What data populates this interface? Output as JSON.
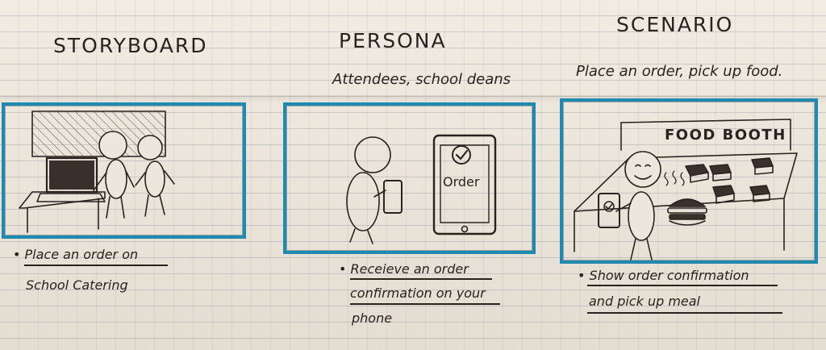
{
  "headings": {
    "storyboard": "STORYBOARD",
    "persona": "PERSONA",
    "scenario": "SCENARIO"
  },
  "subtitles": {
    "persona": "Attendees, school deans",
    "scenario": "Place an order, pick up food."
  },
  "panels": {
    "panel2_phone_label": "Order",
    "panel3_sign": "FOOD BOOTH"
  },
  "captions": {
    "panel1": [
      "Place an order on",
      "School Catering"
    ],
    "panel2": [
      "Receieve an order",
      "confirmation on your",
      "phone"
    ],
    "panel3": [
      "Show order confirmation",
      "and pick up meal"
    ]
  },
  "colors": {
    "frame": "#1f8ab0",
    "ink": "#2a221f",
    "paper": "#ece6dc"
  }
}
